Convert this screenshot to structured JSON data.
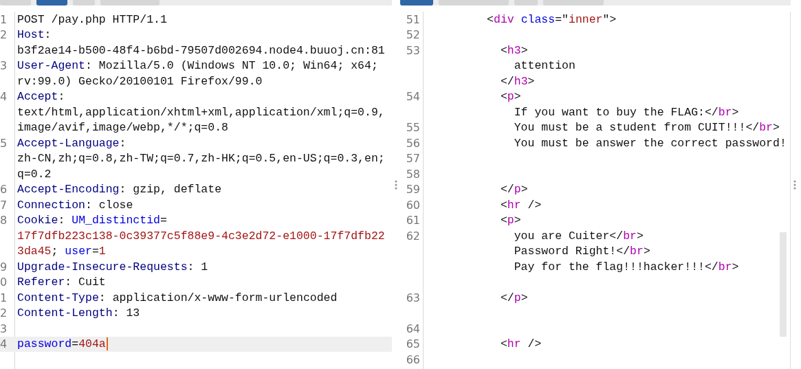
{
  "request_pane": {
    "tabs": [
      {
        "selected": false
      },
      {
        "selected": true
      },
      {
        "selected": false
      },
      {
        "selected": false
      }
    ],
    "rows": [
      {
        "number": "1",
        "active": false,
        "segments": [
          {
            "kind": "text",
            "text": "POST /pay.php HTTP/1.1"
          }
        ]
      },
      {
        "number": "2",
        "active": false,
        "segments": [
          {
            "kind": "header",
            "text": "Host"
          },
          {
            "kind": "text",
            "text": ":"
          }
        ]
      },
      {
        "active": false,
        "segments": [
          {
            "kind": "text",
            "text": "b3f2ae14-b500-48f4-b6bd-79507d002694.node4.buuoj.cn:81"
          }
        ]
      },
      {
        "number": "3",
        "active": false,
        "segments": [
          {
            "kind": "header",
            "text": "User-Agent"
          },
          {
            "kind": "text",
            "text": ": Mozilla/5.0 (Windows NT 10.0; Win64; x64;"
          }
        ]
      },
      {
        "active": false,
        "segments": [
          {
            "kind": "text",
            "text": "rv:99.0) Gecko/20100101 Firefox/99.0"
          }
        ]
      },
      {
        "number": "4",
        "active": false,
        "segments": [
          {
            "kind": "header",
            "text": "Accept"
          },
          {
            "kind": "text",
            "text": ":"
          }
        ]
      },
      {
        "active": false,
        "segments": [
          {
            "kind": "text",
            "text": "text/html,application/xhtml+xml,application/xml;q=0.9,"
          }
        ]
      },
      {
        "active": false,
        "segments": [
          {
            "kind": "text",
            "text": "image/avif,image/webp,*/*;q=0.8"
          }
        ]
      },
      {
        "number": "5",
        "active": false,
        "segments": [
          {
            "kind": "header",
            "text": "Accept-Language"
          },
          {
            "kind": "text",
            "text": ":"
          }
        ]
      },
      {
        "active": false,
        "segments": [
          {
            "kind": "text",
            "text": "zh-CN,zh;q=0.8,zh-TW;q=0.7,zh-HK;q=0.5,en-US;q=0.3,en;"
          }
        ]
      },
      {
        "active": false,
        "segments": [
          {
            "kind": "text",
            "text": "q=0.2"
          }
        ]
      },
      {
        "number": "6",
        "active": false,
        "segments": [
          {
            "kind": "header",
            "text": "Accept-Encoding"
          },
          {
            "kind": "text",
            "text": ": gzip, deflate"
          }
        ]
      },
      {
        "number": "7",
        "active": false,
        "segments": [
          {
            "kind": "header",
            "text": "Connection"
          },
          {
            "kind": "text",
            "text": ": close"
          }
        ]
      },
      {
        "number": "8",
        "active": false,
        "segments": [
          {
            "kind": "header",
            "text": "Cookie"
          },
          {
            "kind": "text",
            "text": ": "
          },
          {
            "kind": "param",
            "text": "UM_distinctid"
          },
          {
            "kind": "text",
            "text": "="
          }
        ]
      },
      {
        "active": false,
        "segments": [
          {
            "kind": "value",
            "text": "17f7dfb223c138-0c39377c5f88e9-4c3e2d72-e1000-17f7dfb22"
          }
        ]
      },
      {
        "active": false,
        "segments": [
          {
            "kind": "value",
            "text": "3da45"
          },
          {
            "kind": "text",
            "text": "; "
          },
          {
            "kind": "param",
            "text": "user"
          },
          {
            "kind": "text",
            "text": "="
          },
          {
            "kind": "value",
            "text": "1"
          }
        ]
      },
      {
        "number": "9",
        "active": false,
        "segments": [
          {
            "kind": "header",
            "text": "Upgrade-Insecure-Requests"
          },
          {
            "kind": "text",
            "text": ": 1"
          }
        ]
      },
      {
        "number": "0",
        "active": false,
        "segments": [
          {
            "kind": "header",
            "text": "Referer"
          },
          {
            "kind": "text",
            "text": ": Cuit"
          }
        ]
      },
      {
        "number": "1",
        "active": false,
        "segments": [
          {
            "kind": "header",
            "text": "Content-Type"
          },
          {
            "kind": "text",
            "text": ": application/x-www-form-urlencoded"
          }
        ]
      },
      {
        "number": "2",
        "active": false,
        "segments": [
          {
            "kind": "header",
            "text": "Content-Length"
          },
          {
            "kind": "text",
            "text": ": 13"
          }
        ]
      },
      {
        "number": "3",
        "active": false,
        "segments": []
      },
      {
        "number": "4",
        "active": true,
        "segments": [
          {
            "kind": "param",
            "text": "password"
          },
          {
            "kind": "text",
            "text": "="
          },
          {
            "kind": "value",
            "text": "404a"
          }
        ]
      }
    ]
  },
  "response_pane": {
    "tabs": [
      {
        "selected": true
      },
      {
        "selected": false
      },
      {
        "selected": false
      },
      {
        "selected": false
      }
    ],
    "rows": [
      {
        "number": "51",
        "segments": [
          {
            "kind": "text",
            "text": "         <"
          },
          {
            "kind": "tag",
            "text": "div"
          },
          {
            "kind": "attr",
            "text": " class"
          },
          {
            "kind": "text",
            "text": "=\""
          },
          {
            "kind": "value",
            "text": "inner"
          },
          {
            "kind": "text",
            "text": "\">"
          }
        ]
      },
      {
        "number": "52",
        "segments": []
      },
      {
        "number": "53",
        "segments": [
          {
            "kind": "text",
            "text": "           <"
          },
          {
            "kind": "tag",
            "text": "h3"
          },
          {
            "kind": "text",
            "text": ">"
          }
        ]
      },
      {
        "segments": [
          {
            "kind": "text",
            "text": "             attention"
          }
        ]
      },
      {
        "segments": [
          {
            "kind": "text",
            "text": "           </"
          },
          {
            "kind": "tag",
            "text": "h3"
          },
          {
            "kind": "text",
            "text": ">"
          }
        ]
      },
      {
        "number": "54",
        "segments": [
          {
            "kind": "text",
            "text": "           <"
          },
          {
            "kind": "tag",
            "text": "p"
          },
          {
            "kind": "text",
            "text": ">"
          }
        ]
      },
      {
        "segments": [
          {
            "kind": "text",
            "text": "             If you want to buy the FLAG:</"
          },
          {
            "kind": "tag",
            "text": "br"
          },
          {
            "kind": "text",
            "text": ">"
          }
        ]
      },
      {
        "number": "55",
        "segments": [
          {
            "kind": "text",
            "text": "             You must be a student from CUIT!!!</"
          },
          {
            "kind": "tag",
            "text": "br"
          },
          {
            "kind": "text",
            "text": ">"
          }
        ]
      },
      {
        "number": "56",
        "segments": [
          {
            "kind": "text",
            "text": "             You must be answer the correct password!"
          }
        ]
      },
      {
        "number": "57",
        "segments": []
      },
      {
        "number": "58",
        "segments": []
      },
      {
        "number": "59",
        "segments": [
          {
            "kind": "text",
            "text": "           </"
          },
          {
            "kind": "tag",
            "text": "p"
          },
          {
            "kind": "text",
            "text": ">"
          }
        ]
      },
      {
        "number": "60",
        "segments": [
          {
            "kind": "text",
            "text": "           <"
          },
          {
            "kind": "tag",
            "text": "hr"
          },
          {
            "kind": "text",
            "text": " />"
          }
        ]
      },
      {
        "number": "61",
        "segments": [
          {
            "kind": "text",
            "text": "           <"
          },
          {
            "kind": "tag",
            "text": "p"
          },
          {
            "kind": "text",
            "text": ">"
          }
        ]
      },
      {
        "number": "62",
        "segments": [
          {
            "kind": "text",
            "text": "             you are Cuiter</"
          },
          {
            "kind": "tag",
            "text": "br"
          },
          {
            "kind": "text",
            "text": ">"
          }
        ]
      },
      {
        "segments": [
          {
            "kind": "text",
            "text": "             Password Right!</"
          },
          {
            "kind": "tag",
            "text": "br"
          },
          {
            "kind": "text",
            "text": ">"
          }
        ]
      },
      {
        "segments": [
          {
            "kind": "text",
            "text": "             Pay for the flag!!!hacker!!!</"
          },
          {
            "kind": "tag",
            "text": "br"
          },
          {
            "kind": "text",
            "text": ">"
          }
        ]
      },
      {
        "segments": []
      },
      {
        "number": "63",
        "segments": [
          {
            "kind": "text",
            "text": "           </"
          },
          {
            "kind": "tag",
            "text": "p"
          },
          {
            "kind": "text",
            "text": ">"
          }
        ]
      },
      {
        "segments": []
      },
      {
        "number": "64",
        "segments": []
      },
      {
        "number": "65",
        "segments": [
          {
            "kind": "text",
            "text": "           <"
          },
          {
            "kind": "tag",
            "text": "hr"
          },
          {
            "kind": "text",
            "text": " />"
          }
        ]
      },
      {
        "number": "66",
        "segments": []
      }
    ]
  }
}
